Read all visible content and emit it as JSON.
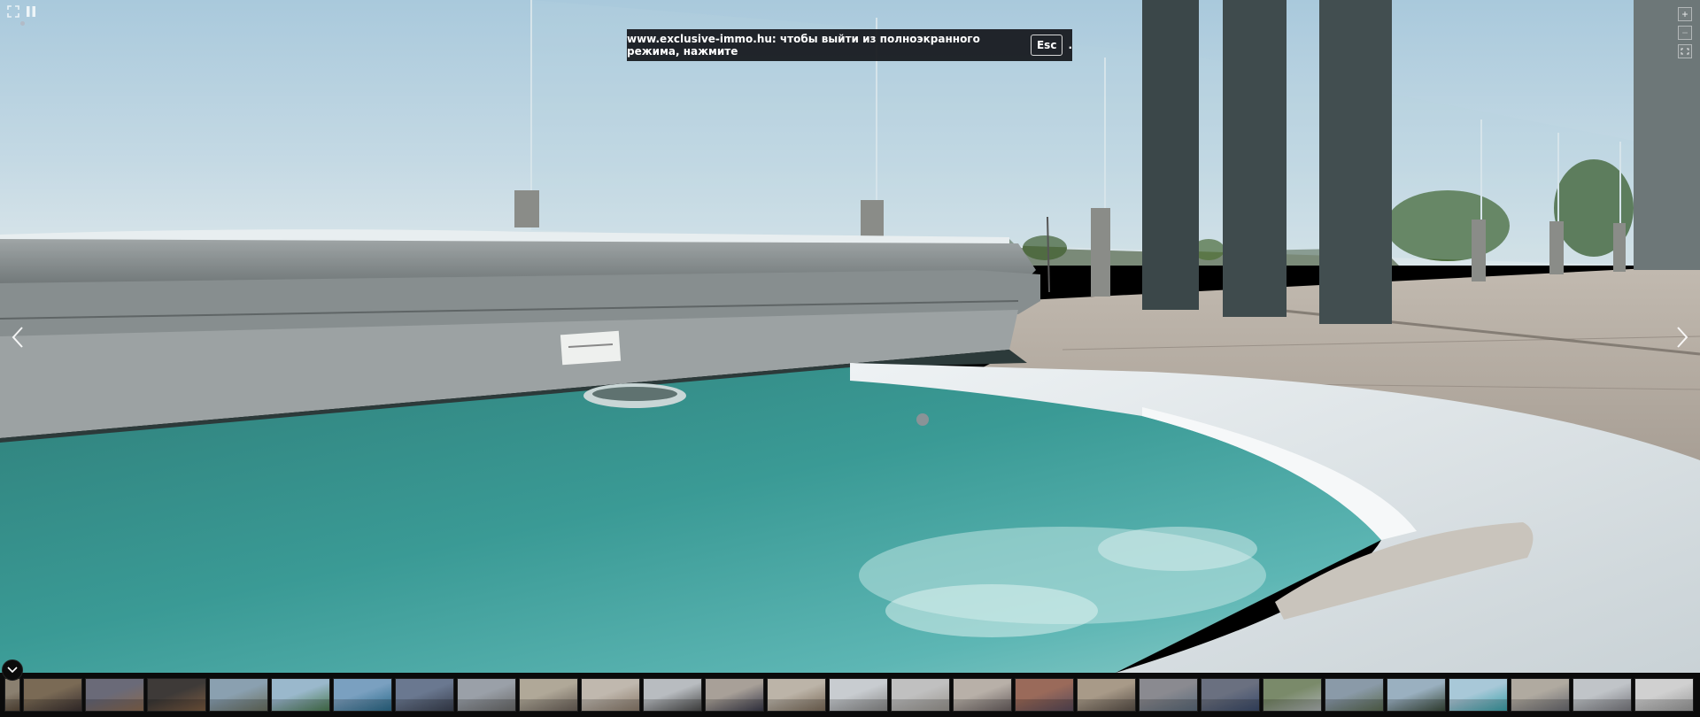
{
  "fullscreen_notice": {
    "message": "www.exclusive-immo.hu: чтобы выйти из полноэкранного режима, нажмите",
    "key": "Esc",
    "suffix": "."
  },
  "controls": {
    "expand_icon": "expand-icon",
    "pause_icon": "pause-icon",
    "zoom_in_label": "+",
    "zoom_out_label": "−",
    "fit_icon": "fit-to-screen-icon",
    "prev_icon": "chevron-left-icon",
    "next_icon": "chevron-right-icon",
    "collapse_icon": "chevron-down-icon"
  },
  "thumbnails": [
    {
      "colors": [
        "#8a8070",
        "#5a4a3a"
      ]
    },
    {
      "colors": [
        "#7a6a55",
        "#3a3030"
      ]
    },
    {
      "colors": [
        "#6a6a78",
        "#8a6a50"
      ]
    },
    {
      "colors": [
        "#3e3a38",
        "#7a5a40"
      ]
    },
    {
      "colors": [
        "#8aa0b0",
        "#6a7060"
      ]
    },
    {
      "colors": [
        "#9ab8cc",
        "#4a7a50"
      ]
    },
    {
      "colors": [
        "#7aa0c0",
        "#2a6a8a"
      ]
    },
    {
      "colors": [
        "#6a7890",
        "#3a4050"
      ]
    },
    {
      "colors": [
        "#9aa0a8",
        "#6a6a6a"
      ]
    },
    {
      "colors": [
        "#b0a898",
        "#6a6058"
      ]
    },
    {
      "colors": [
        "#c0b8ae",
        "#8a7a6a"
      ]
    },
    {
      "colors": [
        "#b8bcc0",
        "#4a4a4a"
      ]
    },
    {
      "colors": [
        "#a8a098",
        "#3a3a4a"
      ]
    },
    {
      "colors": [
        "#bcb4a8",
        "#7a6a58"
      ]
    },
    {
      "colors": [
        "#c8ccd0",
        "#8a8a8a"
      ]
    },
    {
      "colors": [
        "#c0c0c0",
        "#9a9690"
      ]
    },
    {
      "colors": [
        "#b8b0a8",
        "#6a6060"
      ]
    },
    {
      "colors": [
        "#9a6a5a",
        "#5a4a5a"
      ]
    },
    {
      "colors": [
        "#a89a88",
        "#5a5048"
      ]
    },
    {
      "colors": [
        "#8a8a90",
        "#5a6a7a"
      ]
    },
    {
      "colors": [
        "#6a7080",
        "#3a4a6a"
      ]
    },
    {
      "colors": [
        "#7a8a6a",
        "#aab0b0"
      ]
    },
    {
      "colors": [
        "#8a9aa8",
        "#5a6a50"
      ]
    },
    {
      "colors": [
        "#9ab0c0",
        "#3a4a3a"
      ]
    },
    {
      "colors": [
        "#a8c8d8",
        "#3aa0a8"
      ]
    },
    {
      "colors": [
        "#b0aaa0",
        "#6a6a70"
      ]
    },
    {
      "colors": [
        "#c0c4c8",
        "#7a7a80"
      ]
    },
    {
      "colors": [
        "#d0d0d0",
        "#9a9a9a"
      ]
    }
  ]
}
